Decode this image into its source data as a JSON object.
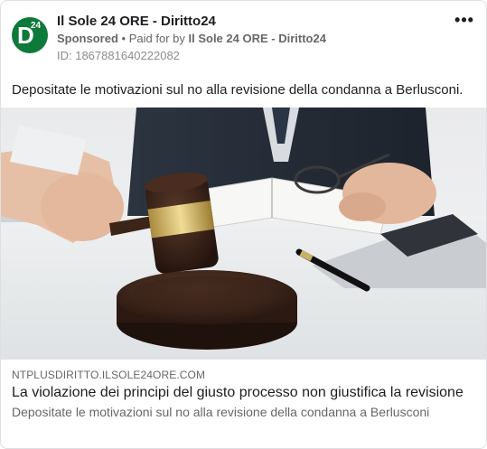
{
  "ad": {
    "page_name": "Il Sole 24 ORE - Diritto24",
    "sponsored_label": "Sponsored",
    "separator": "•",
    "paid_for_prefix": "Paid for by",
    "paid_for_by": "Il Sole 24 ORE - Diritto24",
    "id_line": "ID: 1867881640222082",
    "more_label": "•••",
    "avatar_letter": "D",
    "avatar_number": "24",
    "avatar_color": "#0d7a3a",
    "body_text": "Depositate le motivazioni sul no alla revisione della condanna a Berlusconi."
  },
  "link": {
    "domain": "NTPLUSDIRITTO.ILSOLE24ORE.COM",
    "headline": "La violazione dei principi del giusto processo non giustifica la revisione",
    "description": "Depositate le motivazioni sul no alla revisione della condanna a Berlusconi"
  },
  "image": {
    "subject": "judge-gavel-photo"
  }
}
